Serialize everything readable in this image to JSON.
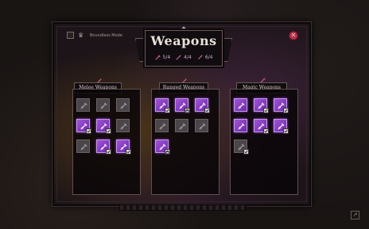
{
  "header": {
    "title": "Weapons",
    "stats": [
      {
        "icon": "sword-icon",
        "text": "5/4"
      },
      {
        "icon": "bow-icon",
        "text": "4/4"
      },
      {
        "icon": "wand-icon",
        "text": "6/4"
      }
    ]
  },
  "boundless_mode": {
    "label": "Boundless Mode",
    "checked": false
  },
  "categories": [
    {
      "name": "Melee Weapons",
      "slots": [
        {
          "state": "locked",
          "badge": false
        },
        {
          "state": "locked",
          "badge": false
        },
        {
          "state": "locked",
          "badge": false
        },
        {
          "state": "owned",
          "badge": "check"
        },
        {
          "state": "owned",
          "badge": "check"
        },
        {
          "state": "locked",
          "badge": false
        },
        {
          "state": "locked",
          "badge": false
        },
        {
          "state": "owned",
          "badge": "check"
        },
        {
          "state": "owned",
          "badge": "check"
        }
      ]
    },
    {
      "name": "Ranged Weapons",
      "slots": [
        {
          "state": "owned",
          "badge": "check"
        },
        {
          "state": "owned",
          "badge": "lock"
        },
        {
          "state": "owned",
          "badge": "check"
        },
        {
          "state": "locked",
          "badge": false
        },
        {
          "state": "locked",
          "badge": false
        },
        {
          "state": "locked",
          "badge": false
        },
        {
          "state": "owned",
          "badge": "lock"
        }
      ]
    },
    {
      "name": "Magic Weapons",
      "slots": [
        {
          "state": "owned",
          "badge": false
        },
        {
          "state": "owned",
          "badge": "check"
        },
        {
          "state": "owned",
          "badge": "check"
        },
        {
          "state": "owned",
          "badge": false
        },
        {
          "state": "owned",
          "badge": "check"
        },
        {
          "state": "owned",
          "badge": "check"
        },
        {
          "state": "locked",
          "badge": "check"
        }
      ]
    }
  ],
  "colors": {
    "owned": "#a253d8",
    "locked": "#4a4548",
    "close": "#b2304a"
  }
}
